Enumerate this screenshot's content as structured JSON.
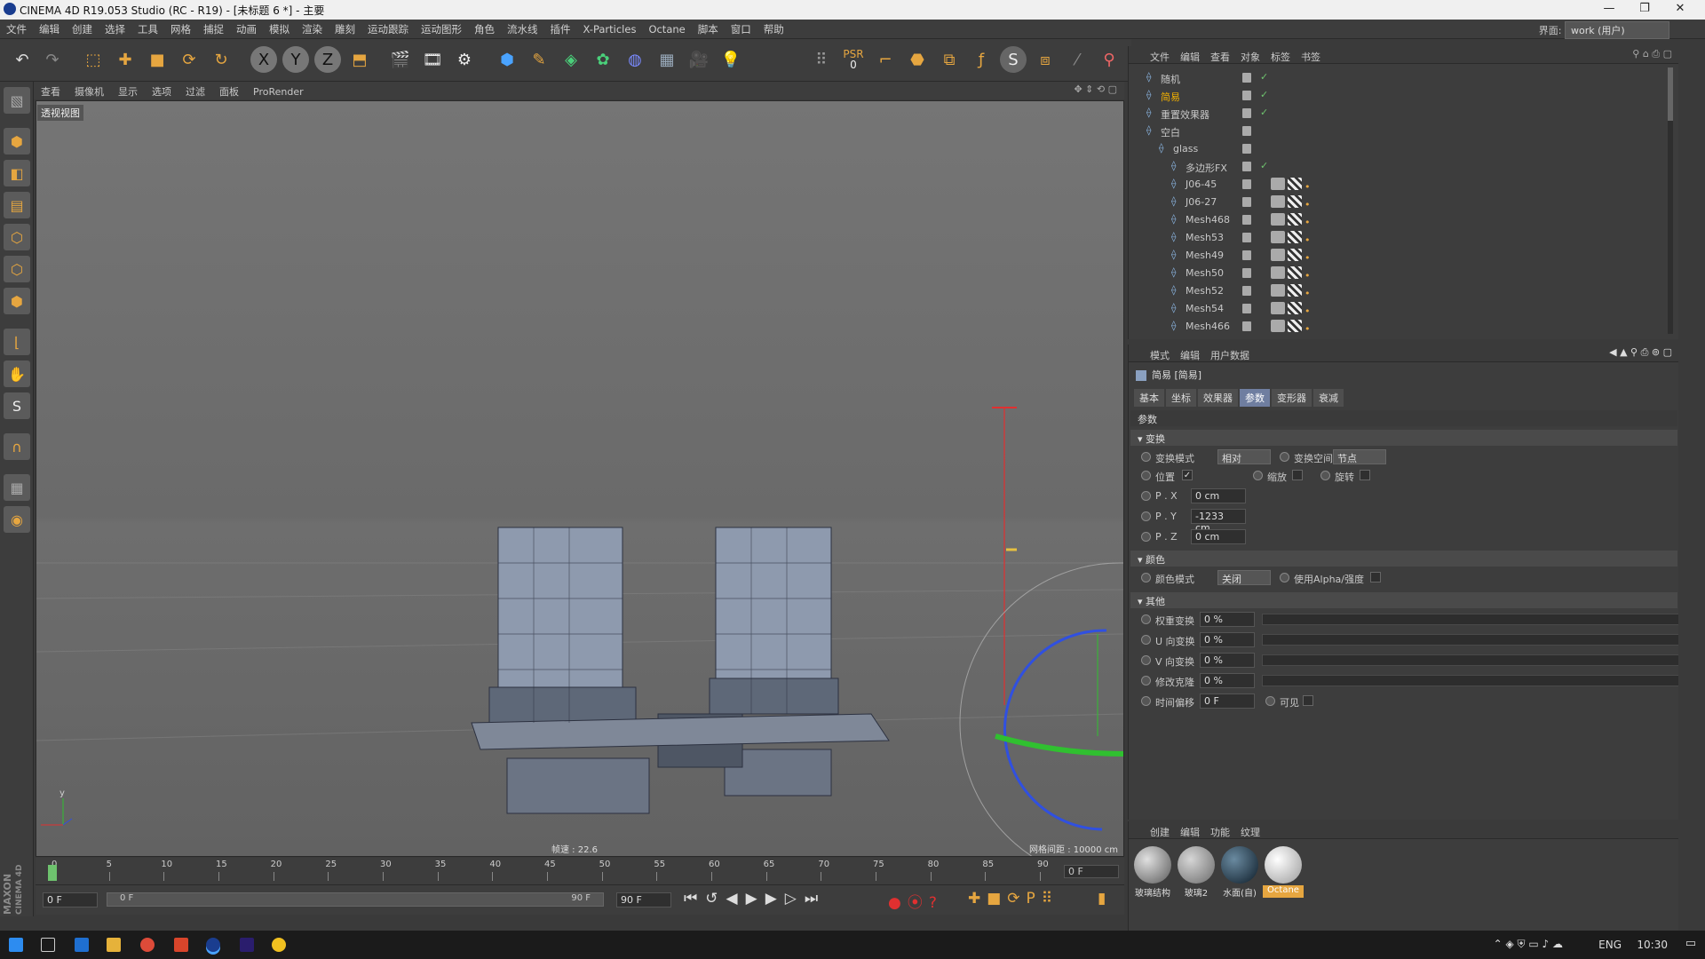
{
  "window": {
    "title": "CINEMA 4D R19.053 Studio (RC - R19) - [未标题 6 *] - 主要"
  },
  "menu": {
    "items": [
      "文件",
      "编辑",
      "创建",
      "选择",
      "工具",
      "网格",
      "捕捉",
      "动画",
      "模拟",
      "渲染",
      "雕刻",
      "运动跟踪",
      "运动图形",
      "角色",
      "流水线",
      "插件",
      "X-Particles",
      "Octane",
      "脚本",
      "窗口",
      "帮助"
    ],
    "interface_label": "界面:",
    "interface_value": "work (用户)"
  },
  "toolbar": {
    "axes": [
      "X",
      "Y",
      "Z"
    ],
    "psr": "PSR",
    "psr_count": "0"
  },
  "viewport": {
    "menu": [
      "查看",
      "摄像机",
      "显示",
      "选项",
      "过滤",
      "面板",
      "ProRender"
    ],
    "label": "透视视图",
    "fps": "帧速 : 22.6",
    "grid": "网格间距 : 10000 cm"
  },
  "timeline": {
    "ticks": [
      "0",
      "5",
      "10",
      "15",
      "20",
      "25",
      "30",
      "35",
      "40",
      "45",
      "50",
      "55",
      "60",
      "65",
      "70",
      "75",
      "80",
      "85",
      "90"
    ],
    "current": "0 F"
  },
  "transport": {
    "start": "0 F",
    "range_start": "0 F",
    "range_end": "90 F",
    "end": "90 F"
  },
  "branding": {
    "maxon": "MAXON",
    "c4d": "CINEMA 4D"
  },
  "object_manager": {
    "menu": [
      "文件",
      "编辑",
      "查看",
      "对象",
      "标签",
      "书签"
    ],
    "objects": [
      {
        "name": "随机",
        "indent": 0,
        "check": true,
        "tags": false,
        "highlight": false
      },
      {
        "name": "简易",
        "indent": 0,
        "check": true,
        "tags": false,
        "highlight": true
      },
      {
        "name": "重置效果器",
        "indent": 0,
        "check": true,
        "tags": false,
        "highlight": false
      },
      {
        "name": "空白",
        "indent": 0,
        "check": false,
        "tags": false,
        "highlight": false
      },
      {
        "name": "glass",
        "indent": 1,
        "check": false,
        "tags": false,
        "highlight": false
      },
      {
        "name": "多边形FX",
        "indent": 2,
        "check": true,
        "tags": false,
        "highlight": false
      },
      {
        "name": "J06-45",
        "indent": 2,
        "check": false,
        "tags": true,
        "highlight": false
      },
      {
        "name": "J06-27",
        "indent": 2,
        "check": false,
        "tags": true,
        "highlight": false
      },
      {
        "name": "Mesh468",
        "indent": 2,
        "check": false,
        "tags": true,
        "highlight": false
      },
      {
        "name": "Mesh53",
        "indent": 2,
        "check": false,
        "tags": true,
        "highlight": false
      },
      {
        "name": "Mesh49",
        "indent": 2,
        "check": false,
        "tags": true,
        "highlight": false
      },
      {
        "name": "Mesh50",
        "indent": 2,
        "check": false,
        "tags": true,
        "highlight": false
      },
      {
        "name": "Mesh52",
        "indent": 2,
        "check": false,
        "tags": true,
        "highlight": false
      },
      {
        "name": "Mesh54",
        "indent": 2,
        "check": false,
        "tags": true,
        "highlight": false
      },
      {
        "name": "Mesh466",
        "indent": 2,
        "check": false,
        "tags": true,
        "highlight": false
      }
    ]
  },
  "attributes": {
    "menu": [
      "模式",
      "编辑",
      "用户数据"
    ],
    "object_title": "简易 [简易]",
    "tabs": [
      "基本",
      "坐标",
      "效果器",
      "参数",
      "变形器",
      "衰减"
    ],
    "active_tab": "参数",
    "section_params": "参数",
    "section_transform": "变换",
    "transform_mode_label": "变换模式",
    "transform_mode_value": "相对",
    "transform_space_label": "变换空间",
    "transform_space_value": "节点",
    "pos_label": "位置",
    "scale_label": "缩放",
    "rot_label": "旋转",
    "px_label": "P . X",
    "px": "0 cm",
    "py_label": "P . Y",
    "py": "-1233 cm",
    "pz_label": "P . Z",
    "pz": "0 cm",
    "section_color": "颜色",
    "color_mode_label": "颜色模式",
    "color_mode_value": "关闭",
    "use_alpha_label": "使用Alpha/强度",
    "section_other": "其他",
    "weight_label": "权重变换",
    "weight": "0 %",
    "u_label": "U 向变换",
    "u": "0 %",
    "v_label": "V 向变换",
    "v": "0 %",
    "mod_label": "修改克隆",
    "mod": "0 %",
    "time_label": "时间偏移",
    "time": "0 F",
    "visible_label": "可见"
  },
  "materials": {
    "menu": [
      "创建",
      "编辑",
      "功能",
      "纹理"
    ],
    "items": [
      "玻璃结构",
      "玻璃2",
      "水面(自)",
      "Octane"
    ],
    "active": "Octane"
  },
  "taskbar": {
    "lang": "ENG",
    "time": "10:30"
  },
  "colors": {
    "accent": "#e6a640",
    "highlight": "#f2b000",
    "axis_x": "#e03030",
    "axis_y": "#30c030",
    "axis_z": "#3050e0"
  }
}
